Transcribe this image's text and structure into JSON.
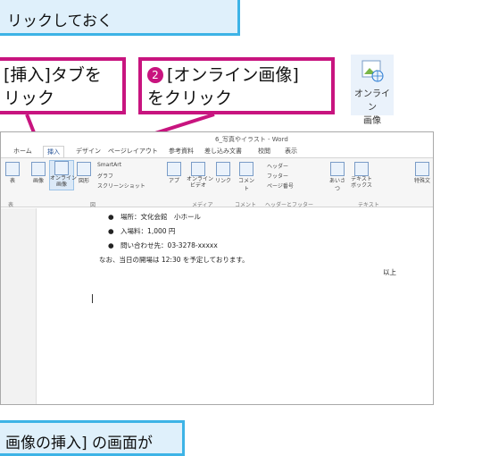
{
  "callout_top": {
    "text": "リックしておく"
  },
  "step1": {
    "line1": "[挿入]タブを",
    "line2": "リック"
  },
  "step2": {
    "number": "2",
    "line1": "[オンライン画像]",
    "line2": "をクリック"
  },
  "desktop_icon": {
    "line1": "オンライン",
    "line2": "画像"
  },
  "window": {
    "title": "6_写真やイラスト - Word",
    "tabs": [
      "ホーム",
      "挿入",
      "デザイン",
      "ページレイアウト",
      "参考資料",
      "差し込み文書",
      "校閲",
      "表示"
    ],
    "ribbon": {
      "table": "表",
      "table_group": "表",
      "picture": "画像",
      "online_picture": "オンライン\n画像",
      "shapes": "図形",
      "smartart": "SmartArt",
      "graph": "グラフ",
      "screenshot": "スクリーンショット",
      "apps": "アプ",
      "online_video": "オンライン\nビデオ",
      "link": "リンク",
      "comment": "コメント",
      "header": "ヘッダー",
      "footer": "フッター",
      "page_number": "ページ番号",
      "greeting": "あいさつ",
      "textbox": "テキスト\nボックス",
      "special_char": "特殊文",
      "group_illust": "図",
      "group_media": "メディア",
      "group_comment": "コメント",
      "group_headerfooter": "ヘッダーとフッター",
      "group_text": "テキスト"
    },
    "doc_lines": [
      "●　場所：文化会館　小ホール",
      "●　入場料：1,000 円",
      "●　問い合わせ先：03-3278-xxxxx",
      "なお、当日の開場は 12:30 を予定しております。",
      "以上"
    ]
  },
  "callout_bottom": {
    "text": "画像の挿入] の画面が"
  }
}
